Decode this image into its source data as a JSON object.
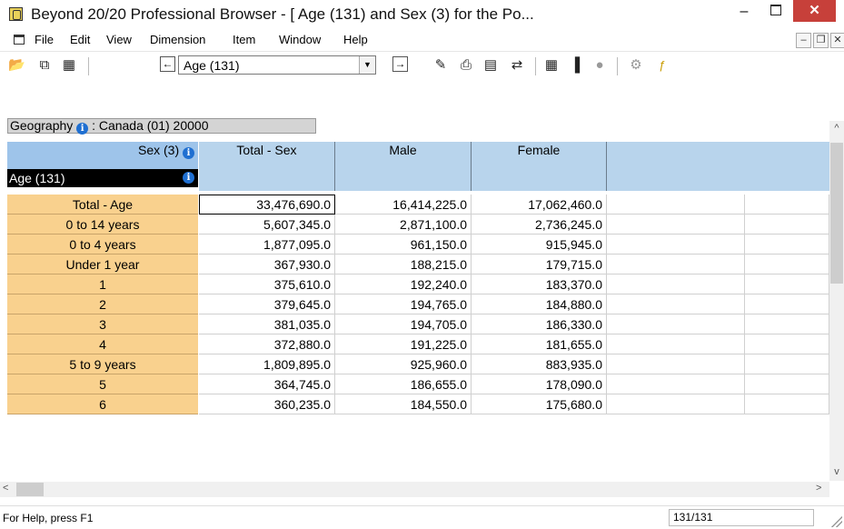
{
  "window": {
    "title": "Beyond 20/20 Professional Browser - [   Age (131) and Sex (3) for the Po...",
    "minimize": "–",
    "close": "✕"
  },
  "menu": [
    "File",
    "Edit",
    "View",
    "Dimension",
    "Item",
    "Window",
    "Help"
  ],
  "mdi_controls": {
    "minimize": "–",
    "restore": "❐",
    "close": "✕"
  },
  "toolbar": {
    "icons": [
      "open-icon",
      "copy-icon",
      "columns-icon",
      "prev-arrow-icon",
      "next-arrow-icon",
      "pencil-icon",
      "print-icon",
      "chart-icon",
      "pivot-icon",
      "table-icon",
      "bar-chart-icon",
      "map-icon",
      "globe-icon",
      "format-icon"
    ],
    "prev": "←",
    "next": "→",
    "dimension_value": "Age (131)",
    "dropdown_arrow": "▼"
  },
  "geography": {
    "label": "Geography",
    "value": ": Canada (01)   20000",
    "info": "i"
  },
  "headers": {
    "sex": "Sex (3)",
    "age": "Age (131)",
    "info": "i",
    "columns": [
      "Total - Sex",
      "Male",
      "Female"
    ]
  },
  "rows": [
    {
      "label": "Total - Age",
      "values": [
        "33,476,690.0",
        "16,414,225.0",
        "17,062,460.0"
      ]
    },
    {
      "label": "0 to 14 years",
      "values": [
        "5,607,345.0",
        "2,871,100.0",
        "2,736,245.0"
      ]
    },
    {
      "label": "0 to 4 years",
      "values": [
        "1,877,095.0",
        "961,150.0",
        "915,945.0"
      ]
    },
    {
      "label": "Under 1 year",
      "values": [
        "367,930.0",
        "188,215.0",
        "179,715.0"
      ]
    },
    {
      "label": "1",
      "values": [
        "375,610.0",
        "192,240.0",
        "183,370.0"
      ]
    },
    {
      "label": "2",
      "values": [
        "379,645.0",
        "194,765.0",
        "184,880.0"
      ]
    },
    {
      "label": "3",
      "values": [
        "381,035.0",
        "194,705.0",
        "186,330.0"
      ]
    },
    {
      "label": "4",
      "values": [
        "372,880.0",
        "191,225.0",
        "181,655.0"
      ]
    },
    {
      "label": "5 to 9 years",
      "values": [
        "1,809,895.0",
        "925,960.0",
        "883,935.0"
      ]
    },
    {
      "label": "5",
      "values": [
        "364,745.0",
        "186,655.0",
        "178,090.0"
      ]
    },
    {
      "label": "6",
      "values": [
        "360,235.0",
        "184,550.0",
        "175,680.0"
      ]
    }
  ],
  "scroll": {
    "up": "^",
    "down": "v",
    "left": "<",
    "right": ">"
  },
  "status": {
    "help": "For Help, press F1",
    "position": "131/131"
  }
}
